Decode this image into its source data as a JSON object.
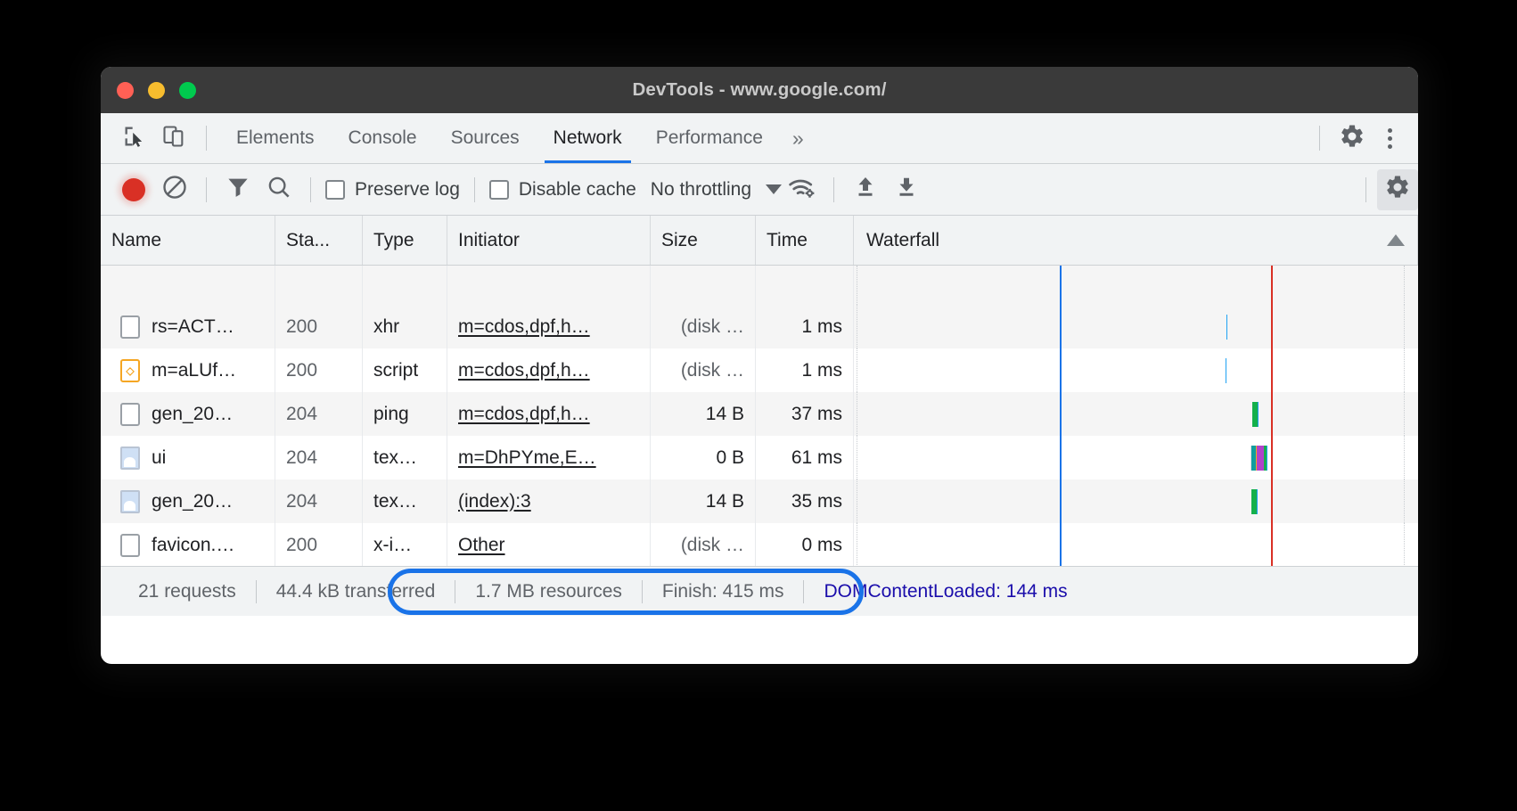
{
  "window": {
    "title": "DevTools - www.google.com/",
    "traffic_lights": [
      "close",
      "minimize",
      "maximize"
    ]
  },
  "tabbar": {
    "inspect_icon": "inspect-cursor-icon",
    "device_icon": "device-toolbar-icon",
    "tabs": [
      {
        "label": "Elements",
        "active": false
      },
      {
        "label": "Console",
        "active": false
      },
      {
        "label": "Sources",
        "active": false
      },
      {
        "label": "Network",
        "active": true
      },
      {
        "label": "Performance",
        "active": false
      }
    ],
    "more_label": "»",
    "settings_icon": "gear-icon",
    "menu_icon": "kebab-menu-icon"
  },
  "network_toolbar": {
    "record_icon": "record-circle-icon",
    "clear_icon": "clear-no-entry-icon",
    "filter_icon": "filter-funnel-icon",
    "search_icon": "search-magnifier-icon",
    "preserve_log": {
      "label": "Preserve log",
      "checked": false
    },
    "disable_cache": {
      "label": "Disable cache",
      "checked": false
    },
    "throttling": {
      "value": "No throttling",
      "caret": "chevron-down-icon"
    },
    "network_conditions_icon": "wifi-gear-icon",
    "import_har_icon": "upload-arrow-icon",
    "export_har_icon": "download-arrow-icon",
    "settings_icon": "network-settings-gear-icon",
    "settings_active": true
  },
  "table": {
    "columns": [
      "Name",
      "Sta...",
      "Type",
      "Initiator",
      "Size",
      "Time",
      "Waterfall"
    ],
    "sort_indicator": "sort-ascending-arrow",
    "rows": [
      {
        "icon": "file-plain-icon",
        "name": "rs=ACT…",
        "status": "200",
        "type": "xhr",
        "initiator": "m=cdos,dpf,h…",
        "size": "(disk …",
        "time": "1 ms"
      },
      {
        "icon": "file-script-icon",
        "name": "m=aLUf…",
        "status": "200",
        "type": "script",
        "initiator": "m=cdos,dpf,h…",
        "size": "(disk …",
        "time": "1 ms"
      },
      {
        "icon": "file-plain-icon",
        "name": "gen_20…",
        "status": "204",
        "type": "ping",
        "initiator": "m=cdos,dpf,h…",
        "size": "14 B",
        "time": "37 ms"
      },
      {
        "icon": "file-image-icon",
        "name": "ui",
        "status": "204",
        "type": "tex…",
        "initiator": "m=DhPYme,E…",
        "size": "0 B",
        "time": "61 ms"
      },
      {
        "icon": "file-image-icon",
        "name": "gen_20…",
        "status": "204",
        "type": "tex…",
        "initiator": "(index):3",
        "size": "14 B",
        "time": "35 ms"
      },
      {
        "icon": "file-plain-icon",
        "name": "favicon.…",
        "status": "200",
        "type": "x-i…",
        "initiator": "Other",
        "size": "(disk …",
        "time": "0 ms"
      }
    ]
  },
  "waterfall": {
    "gridlines_pct": [
      0.5,
      36.5,
      74.0,
      97.5
    ],
    "markers": [
      {
        "name": "domcontentloaded-marker",
        "color": "#1a73e8",
        "pct": 36.5
      },
      {
        "name": "load-marker",
        "color": "#d93025",
        "pct": 74.0
      }
    ],
    "bars": [
      {
        "row": 0,
        "left_pct": 66.0,
        "segments": [
          {
            "kind": "queue",
            "width_pct": 1.0,
            "color": "#dadce0"
          },
          {
            "kind": "recv",
            "width_pct": 1.2,
            "color": "#1fa2f3"
          }
        ]
      },
      {
        "row": 1,
        "left_pct": 65.8,
        "segments": [
          {
            "kind": "queue",
            "width_pct": 1.2,
            "color": "#dadce0"
          },
          {
            "kind": "recv",
            "width_pct": 1.0,
            "color": "#1fa2f3"
          }
        ]
      },
      {
        "row": 2,
        "left_pct": 70.6,
        "segments": [
          {
            "kind": "stalled",
            "width_pct": 0.8,
            "color": "#dadce0"
          },
          {
            "kind": "wait",
            "width_pct": 9.0,
            "color": "#14b04b"
          },
          {
            "kind": "recv",
            "width_pct": 0.8,
            "color": "#1fa2f3"
          }
        ]
      },
      {
        "row": 3,
        "left_pct": 70.3,
        "segments": [
          {
            "kind": "stalled",
            "width_pct": 0.8,
            "color": "#dadce0"
          },
          {
            "kind": "conn",
            "width_pct": 5.0,
            "color": "#0f9d9f"
          },
          {
            "kind": "orange",
            "width_pct": 0.5,
            "color": "#f5a623"
          },
          {
            "kind": "ssl",
            "width_pct": 7.0,
            "color": "#b042c9"
          },
          {
            "kind": "wait",
            "width_pct": 3.4,
            "color": "#14b04b"
          },
          {
            "kind": "recv",
            "width_pct": 0.6,
            "color": "#1fa2f3"
          }
        ]
      },
      {
        "row": 4,
        "left_pct": 70.4,
        "segments": [
          {
            "kind": "stalled",
            "width_pct": 0.7,
            "color": "#dadce0"
          },
          {
            "kind": "wait",
            "width_pct": 8.8,
            "color": "#14b04b"
          },
          {
            "kind": "recv",
            "width_pct": 0.6,
            "color": "#1fa2f3"
          }
        ]
      },
      {
        "row": 5,
        "left_pct": 70.5,
        "segments": [
          {
            "kind": "stalled",
            "width_pct": 0.5,
            "color": "#dadce0"
          },
          {
            "kind": "recv",
            "width_pct": 0.7,
            "color": "#1fa2f3"
          }
        ]
      }
    ]
  },
  "footer": {
    "requests": "21 requests",
    "transferred": "44.4 kB transferred",
    "resources": "1.7 MB resources",
    "finish": "Finish: 415 ms",
    "dom_content_loaded": "DOMContentLoaded: 144 ms",
    "highlight_color": "#1a73e8"
  }
}
